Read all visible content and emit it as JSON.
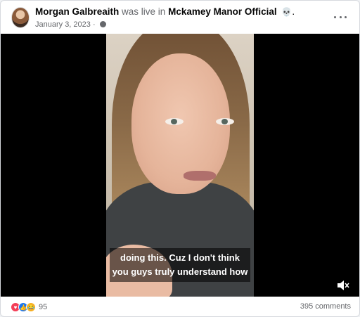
{
  "post": {
    "author": "Morgan Galbreaith",
    "action": "was live in",
    "page": "Mckamey Manor Official",
    "date": "January 3, 2023 ·",
    "more_label": "More options"
  },
  "video": {
    "caption_line1": "doing this. Cuz I don't think",
    "caption_line2": "you guys truly understand how"
  },
  "footer": {
    "reaction_count": "95",
    "comments": "395 comments"
  },
  "colors": {
    "love": "#f33e58",
    "like": "#1877f2",
    "haha": "#f7b125"
  }
}
